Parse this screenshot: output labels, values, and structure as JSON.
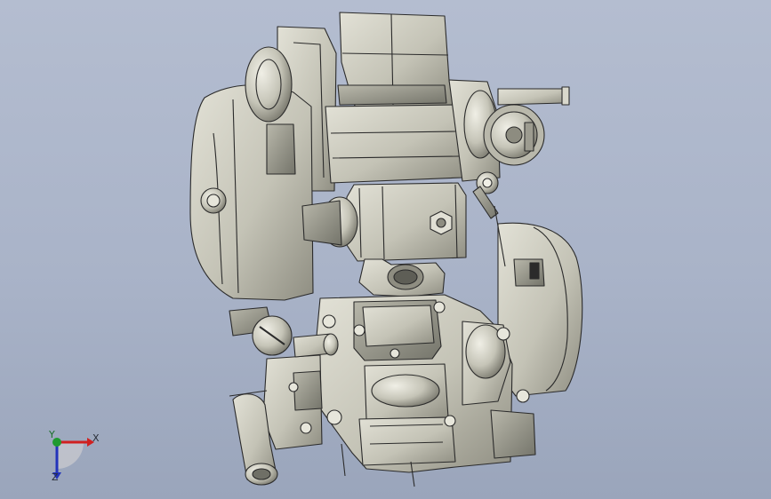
{
  "viewport": {
    "background_top": "#b4bdd0",
    "background_bottom": "#9aa5bb"
  },
  "model": {
    "icon": "engine-3d-model",
    "body_color": "#c9c8bb",
    "shadow_color": "#8d8c80",
    "edge_color": "#2b2b2b"
  },
  "triad": {
    "x_label": "X",
    "y_label": "Y",
    "z_label": "Z",
    "x_color": "#d02020",
    "y_color": "#1f9a2f",
    "z_color": "#2233bb"
  }
}
